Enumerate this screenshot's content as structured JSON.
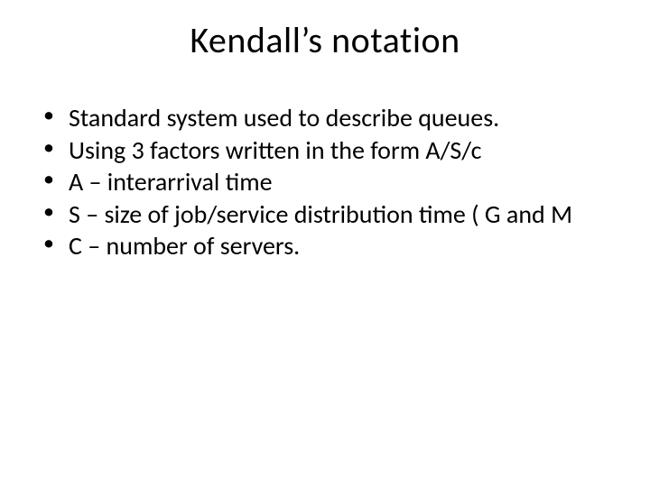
{
  "slide": {
    "title": "Kendall’s notation",
    "bullets": [
      "Standard system used to describe queues.",
      "Using 3 factors written in the form A/S/c",
      "A – interarrival time",
      "S – size of job/service distribution time ( G and M",
      "C – number of servers."
    ]
  }
}
